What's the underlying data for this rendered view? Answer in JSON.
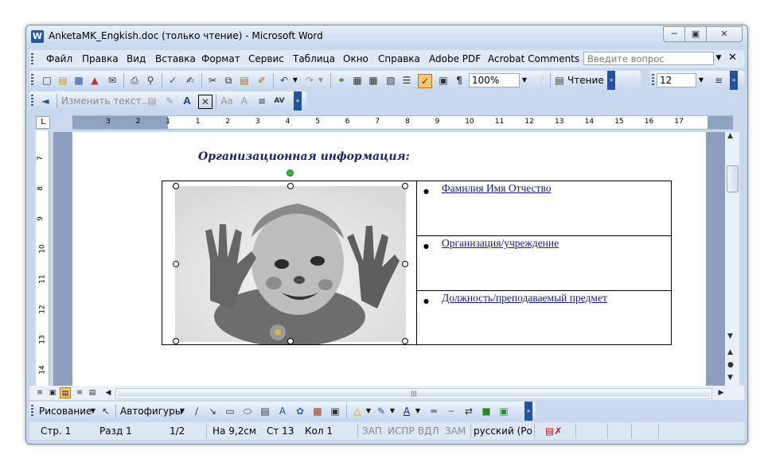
{
  "window": {
    "title": "AnketaMK_Engkish.doc (только чтение) - Microsoft Word",
    "app_icon": "W"
  },
  "menubar": {
    "items": [
      "Файл",
      "Правка",
      "Вид",
      "Вставка",
      "Формат",
      "Сервис",
      "Таблица",
      "Окно",
      "Справка",
      "Adobe PDF",
      "Acrobat Comments"
    ],
    "help_placeholder": "Введите вопрос"
  },
  "toolbar_standard": {
    "zoom": "100%",
    "reading_label": "Чтение",
    "font_size": "12"
  },
  "toolbar_comments": {
    "edit_text_label": "Изменить текст..."
  },
  "ruler": {
    "labels": [
      "3",
      "2",
      "1",
      "1",
      "2",
      "3",
      "4",
      "5",
      "6",
      "7",
      "8",
      "9",
      "10",
      "11",
      "12",
      "13",
      "14",
      "15",
      "16",
      "17"
    ],
    "vertical_labels": [
      "7",
      "8",
      "9",
      "10",
      "11",
      "12",
      "13",
      "14"
    ]
  },
  "document": {
    "heading": "Организационная информация:",
    "fields": [
      "Фамилия Имя Отчество",
      "Организация/учреждение",
      "Должность/преподаваемый предмет"
    ]
  },
  "drawing_toolbar": {
    "draw_label": "Рисование",
    "autoshapes_label": "Автофигуры"
  },
  "statusbar": {
    "page": "Стр. 1",
    "section": "Разд 1",
    "pages": "1/2",
    "position": "На 9,2см",
    "line": "Ст 13",
    "column": "Кол 1",
    "rec": "ЗАП",
    "trk": "ИСПР",
    "ext": "ВДЛ",
    "ovr": "ЗАМ",
    "language": "русский (Ро"
  },
  "colors": {
    "heading": "#1c2260",
    "link": "#1b1b7a",
    "accent_toolbar": "#27519a"
  }
}
